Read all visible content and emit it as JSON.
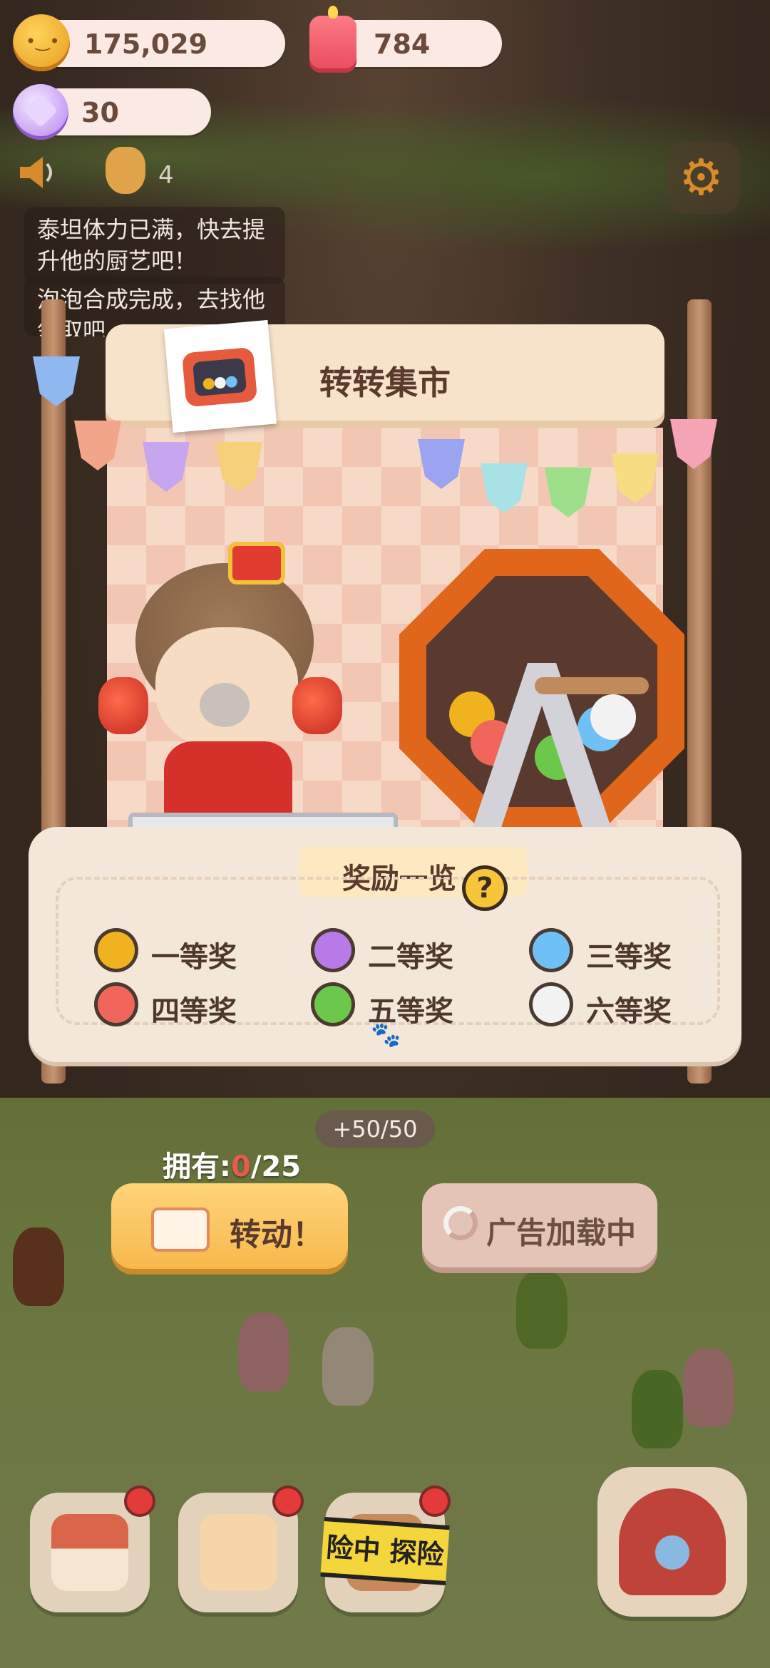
{
  "currency": {
    "coins": "175,029",
    "candles": "784",
    "gems": "30"
  },
  "notices": {
    "count": "4",
    "message1": "泰坦体力已满，快去提升他的厨艺吧！",
    "message2": "泡泡合成完成，去找他领取吧"
  },
  "stall": {
    "title": "转转集市"
  },
  "rewards": {
    "title": "奖励一览",
    "help": "?",
    "prizes": [
      {
        "label": "一等奖",
        "color": "#f0b21f"
      },
      {
        "label": "二等奖",
        "color": "#b87ae6"
      },
      {
        "label": "三等奖",
        "color": "#6fc0f5"
      },
      {
        "label": "四等奖",
        "color": "#f0665a"
      },
      {
        "label": "五等奖",
        "color": "#6cc84a"
      },
      {
        "label": "六等奖",
        "color": "#f2f2f2"
      }
    ]
  },
  "stamina": "+50/50",
  "owned": {
    "prefix": "拥有:",
    "current": "0",
    "total": "/25"
  },
  "buttons": {
    "spin": "转动！",
    "ad": "广告加载中"
  },
  "dock": {
    "tape": "险中 探险"
  },
  "colors": {
    "accent": "#f6b94c",
    "panel": "#f3e7da",
    "title_text": "#5a3a2c"
  }
}
